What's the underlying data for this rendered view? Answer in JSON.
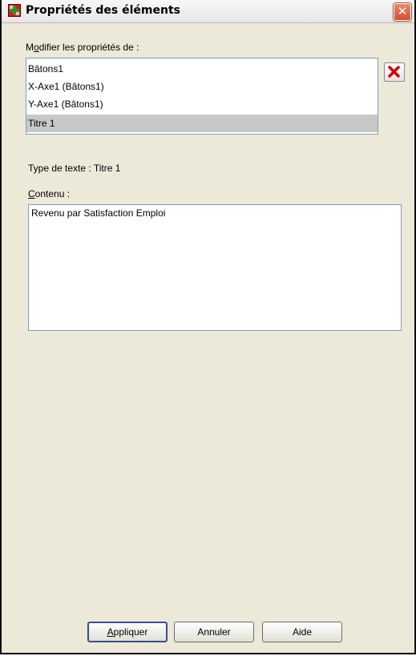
{
  "window": {
    "title": "Propriétés des éléments",
    "close_label": "✕"
  },
  "elements": {
    "label_prefix": "M",
    "label_underlined": "o",
    "label_suffix": "difier les propriétés de :",
    "items": [
      {
        "label": "Bâtons1",
        "selected": false
      },
      {
        "label": "X-Axe1 (Bâtons1)",
        "selected": false
      },
      {
        "label": "Y-Axe1 (Bâtons1)",
        "selected": false
      },
      {
        "label": "Titre 1",
        "selected": true
      }
    ]
  },
  "text_type": "Type de texte : Titre 1",
  "content": {
    "label_underlined": "C",
    "label_suffix": "ontenu :",
    "value": "Revenu par Satisfaction Emploi"
  },
  "buttons": {
    "apply_underlined": "A",
    "apply_suffix": "ppliquer",
    "cancel": "Annuler",
    "help": "Aide"
  },
  "colors": {
    "selection": "#c8c8c8",
    "delete_icon": "#d40000",
    "icon_red": "#cc1f1f",
    "icon_green": "#1e9c2a"
  },
  "icons": {
    "app": "properties-icon",
    "delete": "red-x-icon"
  }
}
